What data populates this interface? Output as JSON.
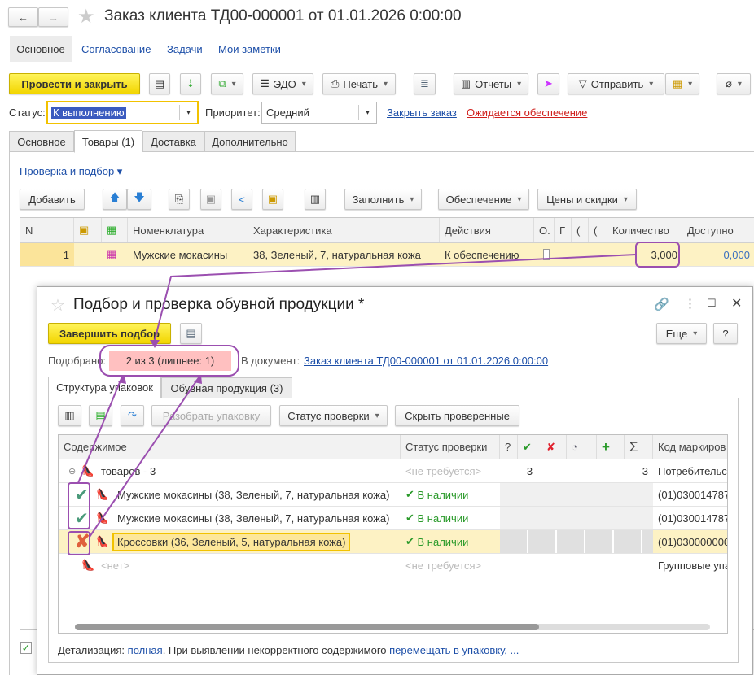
{
  "main_window": {
    "title": "Заказ клиента ТД00-000001 от 01.01.2026 0:00:00",
    "nav_tabs": [
      "Основное",
      "Согласование",
      "Задачи",
      "Мои заметки"
    ],
    "toolbar": {
      "post_close": "Провести и закрыть",
      "edo": "ЭДО",
      "print": "Печать",
      "reports": "Отчеты",
      "send": "Отправить"
    },
    "status_label": "Статус:",
    "status_value": "К выполнению",
    "priority_label": "Приоритет:",
    "priority_value": "Средний",
    "close_order": "Закрыть заказ",
    "awaiting": "Ожидается обеспечение",
    "tabs": [
      "Основное",
      "Товары (1)",
      "Доставка",
      "Дополнительно"
    ],
    "check_pick": "Проверка и подбор",
    "table_toolbar": {
      "add": "Добавить",
      "fill": "Заполнить",
      "supply": "Обеспечение",
      "prices": "Цены и скидки"
    },
    "columns": [
      "N",
      "",
      "",
      "Номенклатура",
      "Характеристика",
      "Действия",
      "О.",
      "Г",
      "(",
      "(",
      "Количество",
      "Доступно"
    ],
    "rows": [
      {
        "n": "1",
        "item": "Мужские мокасины",
        "char": "38, Зеленый, 7, натуральная кожа",
        "action": "К обеспечению",
        "qty": "3,000",
        "available": "0,000"
      }
    ]
  },
  "dialog": {
    "title": "Подбор и проверка обувной продукции *",
    "finish": "Завершить подбор",
    "more": "Еще",
    "help": "?",
    "picked_label": "Подобрано:",
    "picked_value": "2 из 3 (лишнее: 1)",
    "to_doc_label": "В документ:",
    "to_doc_link": "Заказ клиента ТД00-000001 от 01.01.2026 0:00:00",
    "tabs": [
      "Структура упаковок",
      "Обувная продукция (3)"
    ],
    "toolbar": {
      "unpack": "Разобрать упаковку",
      "status": "Статус проверки",
      "hide": "Скрыть проверенные"
    },
    "columns": {
      "content": "Содержимое",
      "status": "Статус проверки",
      "q": "?",
      "sum": "Σ",
      "code": "Код маркиров"
    },
    "rows": [
      {
        "content": "товаров - 3",
        "status": "<не требуется>",
        "c1": "3",
        "c2": "3",
        "code": "Потребительс",
        "mark": "collapse"
      },
      {
        "content": "Мужские мокасины (38, Зеленый, 7, натуральная кожа)",
        "status": "В наличии",
        "code": "(01)030014787",
        "mark": "check"
      },
      {
        "content": "Мужские мокасины (38, Зеленый, 7, натуральная кожа)",
        "status": "В наличии",
        "code": "(01)030014787",
        "mark": "check"
      },
      {
        "content": "Кроссовки (36, Зеленый, 5, натуральная кожа)",
        "status": "В наличии",
        "code": "(01)030000000",
        "mark": "cross"
      },
      {
        "content": "<нет>",
        "status": "<не требуется>",
        "code": "Групповые упа",
        "mark": "none"
      }
    ],
    "footer_label": "Детализация:",
    "footer_link1": "полная",
    "footer_text": ". При выявлении некорректного содержимого",
    "footer_link2": "перемещать в упаковку, ..."
  },
  "colors": {
    "accent_yellow": "#f2d500",
    "annotation": "#9b4fb0",
    "row_highlight": "#fdf2c4",
    "ok_green": "#2a9a2a",
    "error_red": "#e0452c"
  }
}
